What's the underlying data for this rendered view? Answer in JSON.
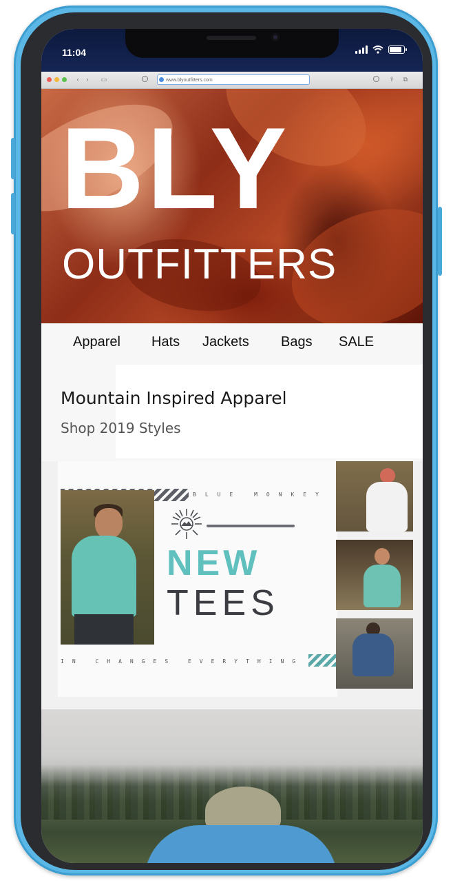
{
  "status_bar": {
    "time": "11:04",
    "battery_level": 0.85
  },
  "browser": {
    "url": "www.blyoutfitters.com"
  },
  "hero": {
    "title": "BLY",
    "subtitle": "OUTFITTERS"
  },
  "nav": {
    "items": [
      "Apparel",
      "Hats",
      "Jackets",
      "Bags",
      "SALE"
    ]
  },
  "promo": {
    "heading": "Mountain Inspired Apparel",
    "subheading": "Shop 2019 Styles"
  },
  "tee_banner": {
    "top_text": "BLUE MONKEY",
    "bottom_text": "IN CHANGES EVERYTHING",
    "line1": "NEW",
    "line2": "TEES",
    "accent_color": "#5fc0be"
  },
  "colors": {
    "device_frame": "#5bb8e6",
    "hero_red": "#8e2d18"
  }
}
